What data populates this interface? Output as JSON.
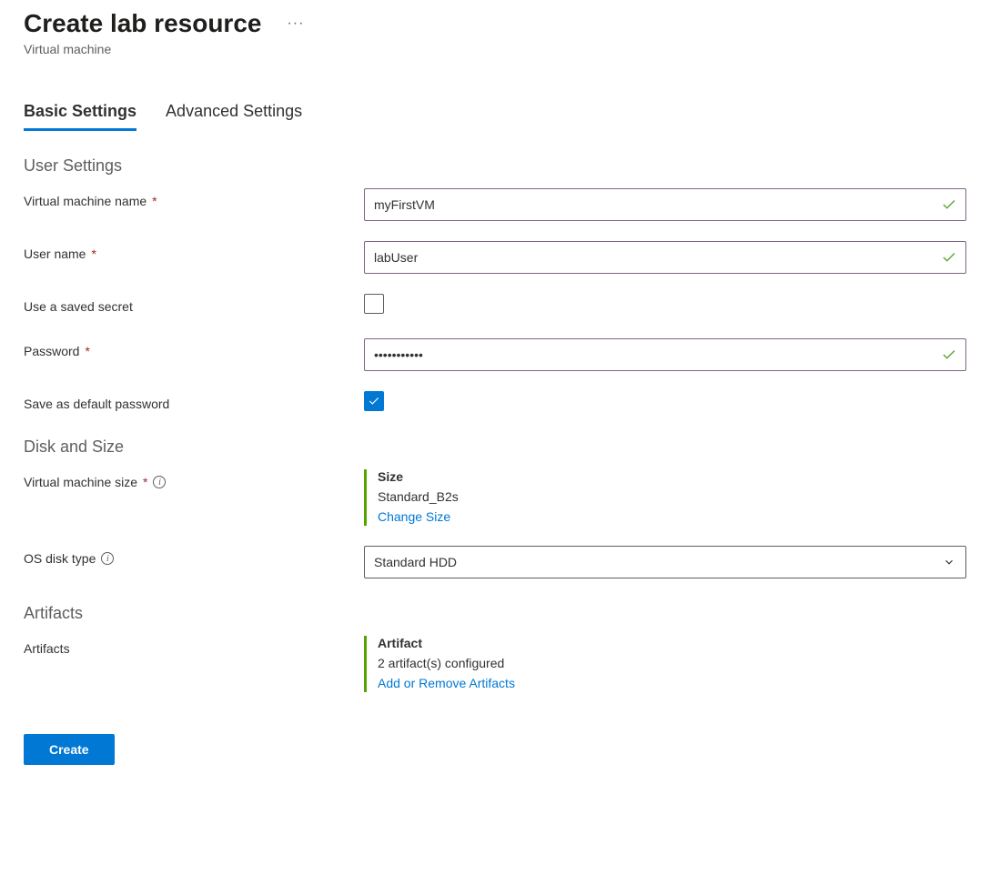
{
  "header": {
    "title": "Create lab resource",
    "subtitle": "Virtual machine"
  },
  "tabs": {
    "basic": "Basic Settings",
    "advanced": "Advanced Settings"
  },
  "sections": {
    "user_settings": "User Settings",
    "disk_and_size": "Disk and Size",
    "artifacts": "Artifacts"
  },
  "fields": {
    "vm_name": {
      "label": "Virtual machine name",
      "value": "myFirstVM"
    },
    "user_name": {
      "label": "User name",
      "value": "labUser"
    },
    "use_saved_secret": {
      "label": "Use a saved secret"
    },
    "password": {
      "label": "Password",
      "value": "•••••••••••"
    },
    "save_default_password": {
      "label": "Save as default password"
    },
    "vm_size": {
      "label": "Virtual machine size",
      "heading": "Size",
      "value": "Standard_B2s",
      "link": "Change Size"
    },
    "os_disk_type": {
      "label": "OS disk type",
      "value": "Standard HDD"
    },
    "artifacts": {
      "label": "Artifacts",
      "heading": "Artifact",
      "value": "2 artifact(s) configured",
      "link": "Add or Remove Artifacts"
    }
  },
  "buttons": {
    "create": "Create"
  }
}
